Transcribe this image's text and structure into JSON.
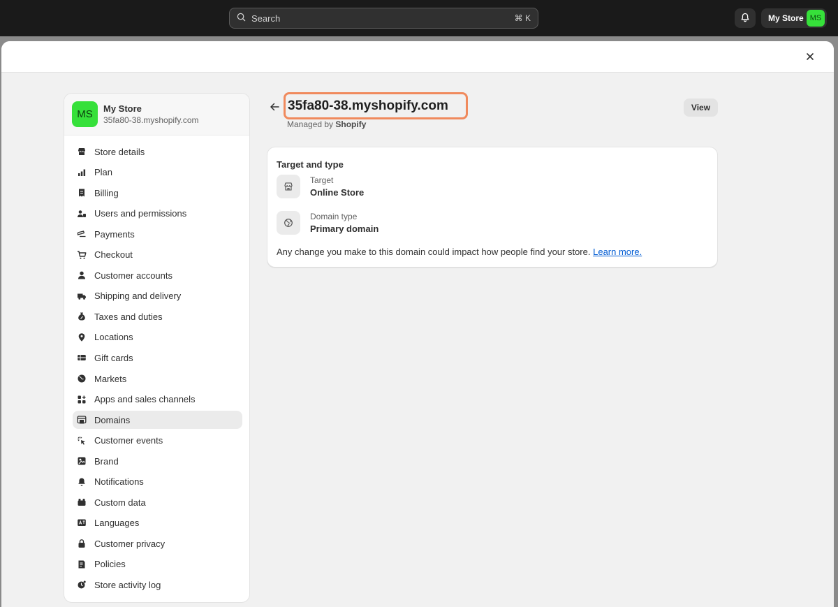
{
  "topbar": {
    "search_placeholder": "Search",
    "search_shortcut": "⌘ K",
    "store_name": "My Store",
    "store_initials": "MS"
  },
  "sidebar": {
    "store_name": "My Store",
    "store_domain": "35fa80-38.myshopify.com",
    "store_initials": "MS",
    "items": [
      {
        "label": "Store details",
        "icon": "store-icon"
      },
      {
        "label": "Plan",
        "icon": "plan-icon"
      },
      {
        "label": "Billing",
        "icon": "billing-icon"
      },
      {
        "label": "Users and permissions",
        "icon": "users-icon"
      },
      {
        "label": "Payments",
        "icon": "payments-icon"
      },
      {
        "label": "Checkout",
        "icon": "cart-icon"
      },
      {
        "label": "Customer accounts",
        "icon": "person-icon"
      },
      {
        "label": "Shipping and delivery",
        "icon": "truck-icon"
      },
      {
        "label": "Taxes and duties",
        "icon": "tax-icon"
      },
      {
        "label": "Locations",
        "icon": "location-icon"
      },
      {
        "label": "Gift cards",
        "icon": "gift-card-icon"
      },
      {
        "label": "Markets",
        "icon": "globe-icon"
      },
      {
        "label": "Apps and sales channels",
        "icon": "apps-icon"
      },
      {
        "label": "Domains",
        "icon": "domains-icon"
      },
      {
        "label": "Customer events",
        "icon": "cursor-icon"
      },
      {
        "label": "Brand",
        "icon": "brand-icon"
      },
      {
        "label": "Notifications",
        "icon": "bell-icon"
      },
      {
        "label": "Custom data",
        "icon": "database-icon"
      },
      {
        "label": "Languages",
        "icon": "language-icon"
      },
      {
        "label": "Customer privacy",
        "icon": "lock-icon"
      },
      {
        "label": "Policies",
        "icon": "policy-icon"
      },
      {
        "label": "Store activity log",
        "icon": "activity-icon"
      }
    ],
    "active_item": "Domains"
  },
  "main": {
    "title": "35fa80-38.myshopify.com",
    "managed_prefix": "Managed by",
    "managed_by": "Shopify",
    "view_label": "View",
    "card": {
      "title": "Target and type",
      "target_label": "Target",
      "target_value": "Online Store",
      "type_label": "Domain type",
      "type_value": "Primary domain",
      "note": "Any change you make to this domain could impact how people find your store.",
      "learn_more": "Learn more."
    }
  }
}
